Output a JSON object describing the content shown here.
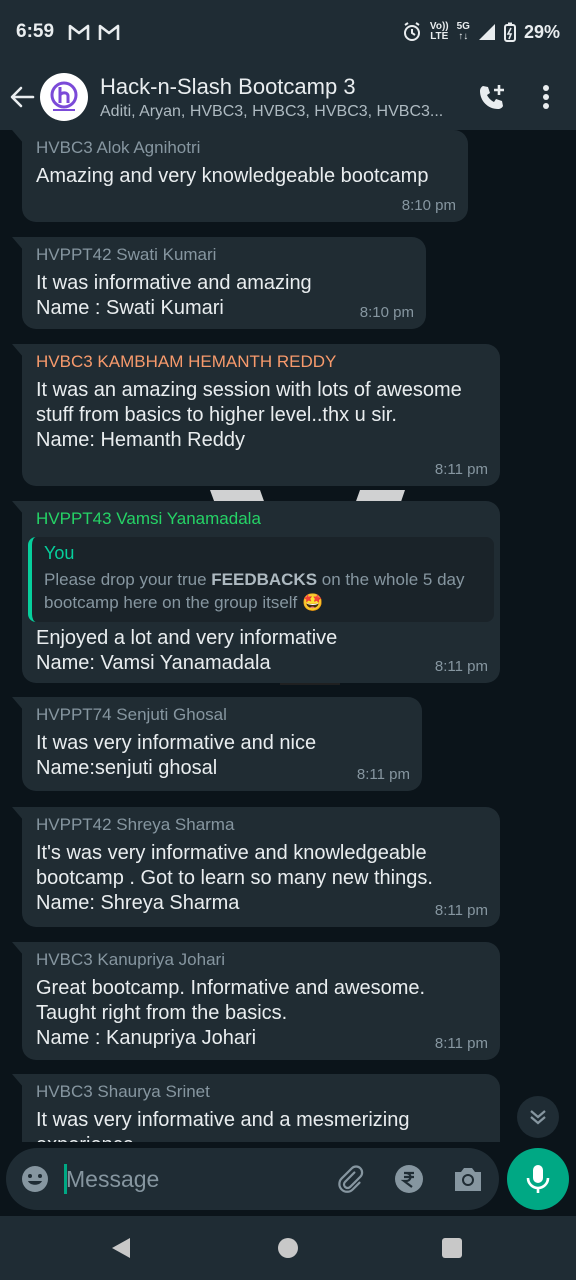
{
  "status_bar": {
    "time": "6:59",
    "network_top": "Vo))",
    "network_bottom": "LTE",
    "signal_label": "5G",
    "battery": "29%"
  },
  "header": {
    "title": "Hack-n-Slash Bootcamp 3",
    "members": "Aditi, Aryan, HVBC3, HVBC3, HVBC3, HVBC3..."
  },
  "messages": [
    {
      "sender": "HVBC3 Alok Agnihotri",
      "sender_color": "#8696a0",
      "text": "Amazing and very knowledgeable bootcamp",
      "time": "8:10 pm"
    },
    {
      "sender": "HVPPT42 Swati Kumari",
      "sender_color": "#8696a0",
      "text": "It was informative and amazing\nName : Swati Kumari",
      "time": "8:10 pm"
    },
    {
      "sender": "HVBC3 KAMBHAM HEMANTH REDDY",
      "sender_color": "#f79a6c",
      "text": "It was an amazing session with lots of awesome stuff from basics to higher level..thx u sir.\nName: Hemanth Reddy",
      "time": "8:11 pm"
    },
    {
      "sender": "HVPPT43 Vamsi Yanamadala",
      "sender_color": "#25d366",
      "quote": {
        "author": "You",
        "text_before": "Please drop your true ",
        "text_bold": "FEEDBACKS",
        "text_after": " on the whole 5 day bootcamp here on the group itself 🤩"
      },
      "text": "Enjoyed a lot and very informative\nName: Vamsi Yanamadala",
      "time": "8:11 pm"
    },
    {
      "sender": "HVPPT74 Senjuti Ghosal",
      "sender_color": "#8696a0",
      "text": "It was very informative and nice\nName:senjuti ghosal",
      "time": "8:11 pm"
    },
    {
      "sender": "HVPPT42 Shreya Sharma",
      "sender_color": "#8696a0",
      "text": "It's was very informative and knowledgeable bootcamp . Got to learn so many new things.\nName: Shreya Sharma",
      "time": "8:11 pm"
    },
    {
      "sender": "HVBC3 Kanupriya Johari",
      "sender_color": "#8696a0",
      "text": "Great bootcamp. Informative and awesome. Taught right from the basics.\nName : Kanupriya Johari",
      "time": "8:11 pm"
    },
    {
      "sender": "HVBC3 Shaurya Srinet",
      "sender_color": "#8696a0",
      "text": "It was very informative and a mesmerizing experience",
      "time": ""
    }
  ],
  "composer": {
    "placeholder": "Message"
  },
  "colors": {
    "accent": "#00a884",
    "bubble": "#202c33",
    "background": "#0b141a"
  }
}
